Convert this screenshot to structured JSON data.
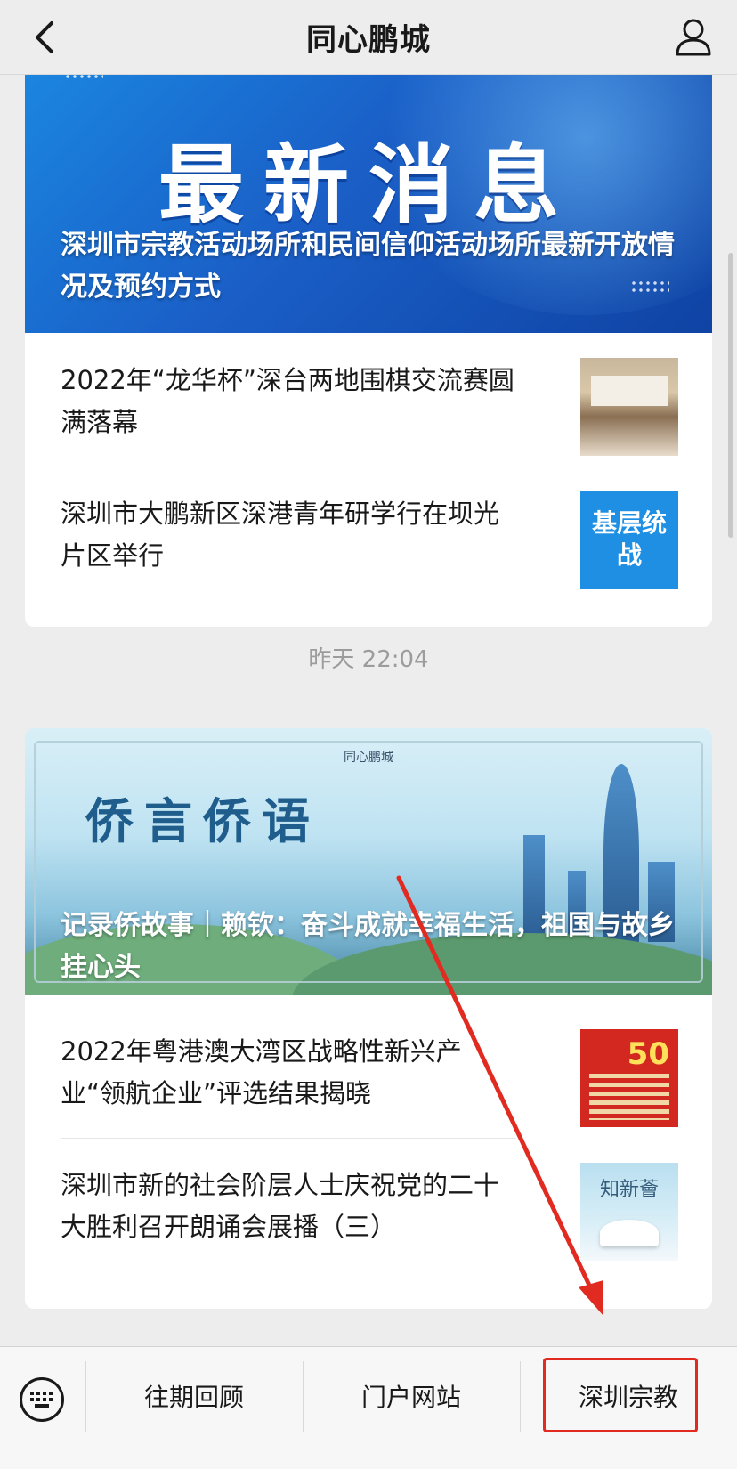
{
  "header": {
    "title": "同心鹏城"
  },
  "feed": {
    "card1": {
      "banner_headline": "最新消息",
      "banner_caption": "深圳市宗教活动场所和民间信仰活动场所最新开放情况及预约方式",
      "items": [
        {
          "title": "2022年“龙华杯”深台两地围棋交流赛圆满落幕"
        },
        {
          "title": "深圳市大鹏新区深港青年研学行在坝光片区举行",
          "thumb_text": "基层统战"
        }
      ]
    },
    "timestamp": "昨天 22:04",
    "card2": {
      "banner_brand": "同心鹏城",
      "banner_headline": "侨言侨语",
      "banner_caption": "记录侨故事｜赖钦：奋斗成就幸福生活，祖国与故乡挂心头",
      "items": [
        {
          "title": "2022年粤港澳大湾区战略性新兴产业“领航企业”评选结果揭晓",
          "thumb_number": "50"
        },
        {
          "title": "深圳市新的社会阶层人士庆祝党的二十大胜利召开朗诵会展播（三）",
          "thumb_text": "知新薈"
        }
      ]
    }
  },
  "bottom_menu": {
    "items": [
      {
        "label": "往期回顾"
      },
      {
        "label": "门户网站"
      },
      {
        "label": "深圳宗教"
      }
    ]
  },
  "colors": {
    "highlight": "#e12a20",
    "background": "#ededed"
  },
  "icons": {
    "back": "chevron-left-icon",
    "profile": "person-icon",
    "keyboard": "keyboard-icon"
  }
}
